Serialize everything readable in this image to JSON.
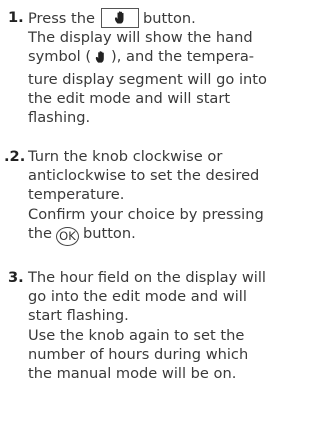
{
  "steps": [
    {
      "number": "1.",
      "line1_before": "Press the",
      "line1_after": "button.",
      "line2": "The display will show the hand",
      "line3_before": "symbol (",
      "line3_after": "), and the tempera-",
      "line4": "ture display segment will go into",
      "line5": "the edit mode and will start",
      "line6": "flashing."
    },
    {
      "number": ".2.",
      "line1": "Turn the knob clockwise or",
      "line2": "anticlockwise to set the desired",
      "line3": "temperature.",
      "line4": "Confirm your choice by pressing",
      "line5_before": "the",
      "ok_label": "OK",
      "line5_after": "button."
    },
    {
      "number": "3.",
      "line1": "The hour field on the display will",
      "line2": "go into the edit mode and will",
      "line3": "start flashing.",
      "line4": "Use the knob again to set the",
      "line5": "number of hours  during which",
      "line6": "the manual mode will be on."
    }
  ],
  "icons": {
    "button_icon": "hand-icon",
    "inline_icon": "hand-icon"
  }
}
